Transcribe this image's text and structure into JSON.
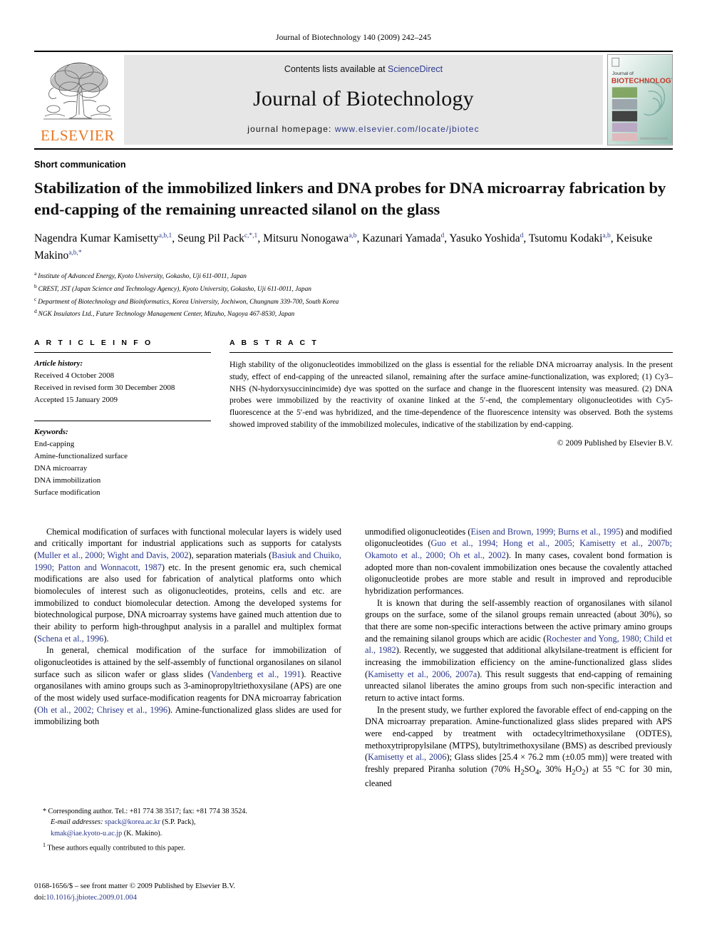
{
  "running_head": "Journal of Biotechnology 140 (2009) 242–245",
  "masthead": {
    "contents_prefix": "Contents lists available at ",
    "sciencedirect": "ScienceDirect",
    "journal_title": "Journal of Biotechnology",
    "homepage_prefix": "journal homepage: ",
    "homepage_url": "www.elsevier.com/locate/jbiotec",
    "publisher_wordmark": "ELSEVIER",
    "cover_label_small": "Journal of",
    "cover_label_big": "BIOTECHNOLOGY",
    "colors": {
      "link_blue": "#2e3a8c",
      "elsevier_orange": "#E87722",
      "banner_gray": "#e6e6e6"
    }
  },
  "article": {
    "kind": "Short communication",
    "title": "Stabilization of the immobilized linkers and DNA probes for DNA microarray fabrication by end-capping of the remaining unreacted silanol on the glass",
    "authors": [
      {
        "name": "Nagendra Kumar Kamisetty",
        "marks": "a,b,1",
        "sep": ", "
      },
      {
        "name": "Seung Pil Pack",
        "marks": "c,*,1",
        "sep": ", "
      },
      {
        "name": "Mitsuru Nonogawa",
        "marks": "a,b",
        "sep": ", "
      },
      {
        "name": "Kazunari Yamada",
        "marks": "d",
        "sep": ", "
      },
      {
        "name": "Yasuko Yoshida",
        "marks": "d",
        "sep": ", "
      },
      {
        "name": "Tsutomu Kodaki",
        "marks": "a,b",
        "sep": ", "
      },
      {
        "name": "Keisuke Makino",
        "marks": "a,b,*",
        "sep": ""
      }
    ],
    "affiliations": [
      {
        "mark": "a",
        "text": "Institute of Advanced Energy, Kyoto University, Gokasho, Uji 611-0011, Japan"
      },
      {
        "mark": "b",
        "text": "CREST, JST (Japan Science and Technology Agency), Kyoto University, Gokasho, Uji 611-0011, Japan"
      },
      {
        "mark": "c",
        "text": "Department of Biotechnology and Bioinformatics, Korea University, Jochiwon, Chungnam 339-700, South Korea"
      },
      {
        "mark": "d",
        "text": "NGK Insulators Ltd., Future Technology Management Center, Mizuho, Nagoya 467-8530, Japan"
      }
    ]
  },
  "article_info": {
    "heading": "A R T I C L E   I N F O",
    "history_label": "Article history:",
    "history": [
      "Received 4 October 2008",
      "Received in revised form 30 December 2008",
      "Accepted 15 January 2009"
    ],
    "keywords_label": "Keywords:",
    "keywords": [
      "End-capping",
      "Amine-functionalized surface",
      "DNA microarray",
      "DNA immobilization",
      "Surface modification"
    ]
  },
  "abstract": {
    "heading": "A B S T R A C T",
    "text": "High stability of the oligonucleotides immobilized on the glass is essential for the reliable DNA microarray analysis. In the present study, effect of end-capping of the unreacted silanol, remaining after the surface amine-functionalization, was explored; (1) Cy3–NHS (N-hydorxysuccinincimide) dye was spotted on the surface and change in the fluorescent intensity was measured. (2) DNA probes were immobilized by the reactivity of oxanine linked at the 5′-end, the complementary oligonucleotides with Cy5-fluorescence at the 5′-end was hybridized, and the time-dependence of the fluorescence intensity was observed. Both the systems showed improved stability of the immobilized molecules, indicative of the stabilization by end-capping.",
    "copyright": "© 2009 Published by Elsevier B.V."
  },
  "body": {
    "left": [
      {
        "indent": true,
        "runs": [
          {
            "t": "Chemical modification of surfaces with functional molecular layers is widely used and critically important for industrial applications such as supports for catalysts ("
          },
          {
            "t": "Muller et al., 2000; Wight and Davis, 2002",
            "cite": true
          },
          {
            "t": "), separation materials ("
          },
          {
            "t": "Basiuk and Chuiko, 1990; Patton and Wonnacott, 1987",
            "cite": true
          },
          {
            "t": ") etc. In the present genomic era, such chemical modifications are also used for fabrication of analytical platforms onto which biomolecules of interest such as oligonucleotides, proteins, cells and etc. are immobilized to conduct biomolecular detection. Among the developed systems for biotechnological purpose, DNA microarray systems have gained much attention due to their ability to perform high-throughput analysis in a parallel and multiplex format ("
          },
          {
            "t": "Schena et al., 1996",
            "cite": true
          },
          {
            "t": ")."
          }
        ]
      },
      {
        "indent": true,
        "runs": [
          {
            "t": "In general, chemical modification of the surface for immobilization of oligonucleotides is attained by the self-assembly of functional organosilanes on silanol surface such as silicon wafer or glass slides ("
          },
          {
            "t": "Vandenberg et al., 1991",
            "cite": true
          },
          {
            "t": "). Reactive organosilanes with amino groups such as 3-aminopropyltriethoxysilane (APS) are one of the most widely used surface-modification reagents for DNA microarray fabrication ("
          },
          {
            "t": "Oh et al., 2002; Chrisey et al., 1996",
            "cite": true
          },
          {
            "t": "). Amine-functionalized glass slides are used for immobilizing both"
          }
        ]
      }
    ],
    "right": [
      {
        "indent": false,
        "runs": [
          {
            "t": "unmodified oligonucleotides ("
          },
          {
            "t": "Eisen and Brown, 1999; Burns et al., 1995",
            "cite": true
          },
          {
            "t": ") and modified oligonucleotides ("
          },
          {
            "t": "Guo et al., 1994; Hong et al., 2005; Kamisetty et al., 2007b; Okamoto et al., 2000; Oh et al., 2002",
            "cite": true
          },
          {
            "t": "). In many cases, covalent bond formation is adopted more than non-covalent immobilization ones because the covalently attached oligonucleotide probes are more stable and result in improved and reproducible hybridization performances."
          }
        ]
      },
      {
        "indent": true,
        "runs": [
          {
            "t": "It is known that during the self-assembly reaction of organosilanes with silanol groups on the surface, some of the silanol groups remain unreacted (about 30%), so that there are some non-specific interactions between the active primary amino groups and the remaining silanol groups which are acidic ("
          },
          {
            "t": "Rochester and Yong, 1980; Child et al., 1982",
            "cite": true
          },
          {
            "t": "). Recently, we suggested that additional alkylsilane-treatment is efficient for increasing the immobilization efficiency on the amine-functionalized glass slides ("
          },
          {
            "t": "Kamisetty et al., 2006, 2007a",
            "cite": true
          },
          {
            "t": "). This result suggests that end-capping of remaining unreacted silanol liberates the amino groups from such non-specific interaction and return to active intact forms."
          }
        ]
      },
      {
        "indent": true,
        "runs": [
          {
            "t": "In the present study, we further explored the favorable effect of end-capping on the DNA microarray preparation. Amine-functionalized glass slides prepared with APS were end-capped by treatment with octadecyltrimethoxysilane (ODTES), methoxytripropylsilane (MTPS), butyltrimethoxysilane (BMS) as described previously ("
          },
          {
            "t": "Kamisetty et al., 2006",
            "cite": true
          },
          {
            "t": "); Glass slides [25.4 × 76.2 mm (±0.05 mm)] were treated with freshly prepared Piranha solution (70% H"
          },
          {
            "t": "2",
            "sub": true
          },
          {
            "t": "SO"
          },
          {
            "t": "4",
            "sub": true
          },
          {
            "t": ", 30% H"
          },
          {
            "t": "2",
            "sub": true
          },
          {
            "t": "O"
          },
          {
            "t": "2",
            "sub": true
          },
          {
            "t": ") at 55 °C for 30 min, cleaned"
          }
        ]
      }
    ]
  },
  "footnotes": {
    "corresponding": {
      "marker": "*",
      "text": "Corresponding author. Tel.: +81 774 38 3517; fax: +81 774 38 3524.",
      "email_label": "E-mail addresses:",
      "email1": "spack@korea.ac.kr",
      "email1_owner": "(S.P. Pack),",
      "email2": "kmak@iae.kyoto-u.ac.jp",
      "email2_owner": "(K. Makino)."
    },
    "equal_contribution": {
      "marker": "1",
      "text": "These authors equally contributed to this paper."
    }
  },
  "imprint": {
    "line1": "0168-1656/$ – see front matter © 2009 Published by Elsevier B.V.",
    "doi_label": "doi:",
    "doi": "10.1016/j.jbiotec.2009.01.004"
  }
}
